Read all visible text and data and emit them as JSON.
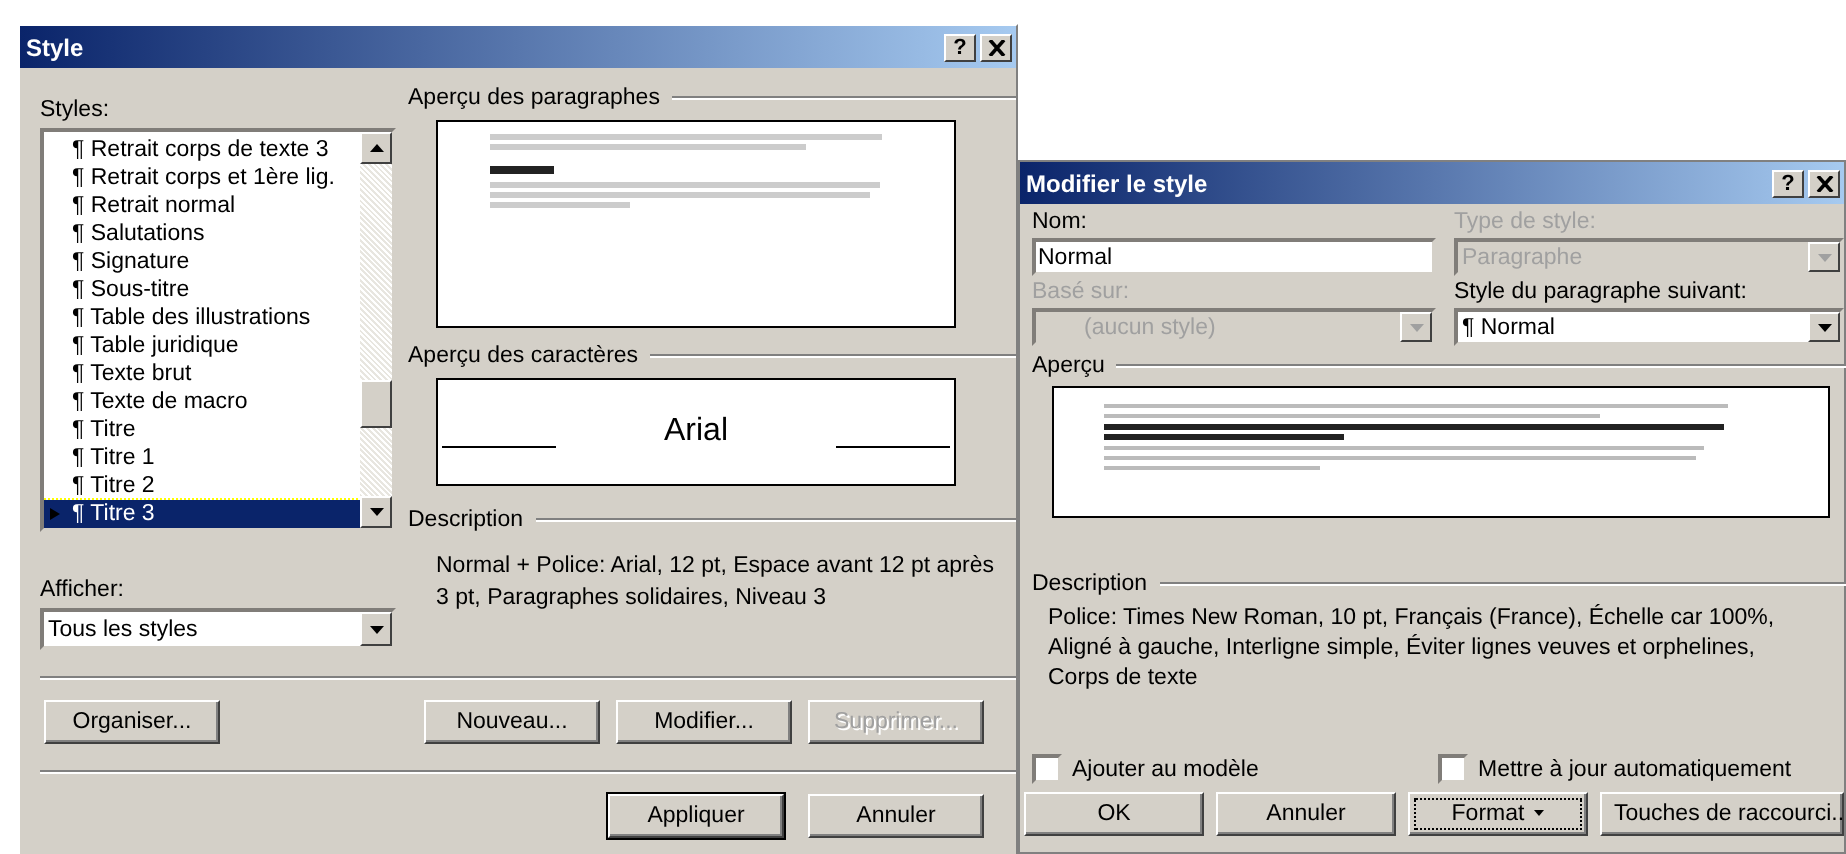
{
  "style_dialog": {
    "title": "Style",
    "help": "?",
    "styles_label": "Styles:",
    "styles": [
      {
        "label": "¶ Retrait corps de texte 3",
        "selected": false
      },
      {
        "label": "¶ Retrait corps et 1ère lig.",
        "selected": false
      },
      {
        "label": "¶ Retrait normal",
        "selected": false
      },
      {
        "label": "¶ Salutations",
        "selected": false
      },
      {
        "label": "¶ Signature",
        "selected": false
      },
      {
        "label": "¶ Sous-titre",
        "selected": false
      },
      {
        "label": "¶ Table des illustrations",
        "selected": false
      },
      {
        "label": "¶ Table juridique",
        "selected": false
      },
      {
        "label": "¶ Texte brut",
        "selected": false
      },
      {
        "label": "¶ Texte de macro",
        "selected": false
      },
      {
        "label": "¶ Titre",
        "selected": false
      },
      {
        "label": "¶ Titre 1",
        "selected": false
      },
      {
        "label": "¶ Titre 2",
        "selected": false
      },
      {
        "label": "¶ Titre 3",
        "selected": true
      }
    ],
    "show_label": "Afficher:",
    "show_value": "Tous les styles",
    "paragraph_preview_label": "Aperçu des paragraphes",
    "character_preview_label": "Aperçu des caractères",
    "character_preview_font": "Arial",
    "description_label": "Description",
    "description": "Normal + Police: Arial, 12 pt, Espace avant 12 pt après 3 pt, Paragraphes solidaires, Niveau 3",
    "action_buttons": [
      {
        "label": "Organiser...",
        "disabled": false
      },
      {
        "label": "Nouveau...",
        "disabled": false
      },
      {
        "label": "Modifier...",
        "disabled": false
      },
      {
        "label": "Supprimer...",
        "disabled": true
      }
    ],
    "bottom_buttons": [
      {
        "label": "Appliquer",
        "default": true
      },
      {
        "label": "Annuler",
        "default": false
      }
    ]
  },
  "modify_dialog": {
    "title": "Modifier le style",
    "help": "?",
    "fields": [
      {
        "label": "Nom:",
        "value": "Normal",
        "kind": "text",
        "disabled": false
      },
      {
        "label": "Type de style:",
        "value": "Paragraphe",
        "kind": "dropdown",
        "disabled": true
      },
      {
        "label": "Basé sur:",
        "value": "(aucun style)",
        "kind": "dropdown",
        "disabled": true
      },
      {
        "label": "Style du paragraphe suivant:",
        "value": "¶ Normal",
        "kind": "dropdown",
        "disabled": false
      }
    ],
    "preview_label": "Aperçu",
    "description_label": "Description",
    "description": "Police: Times New Roman, 10 pt, Français (France), Échelle car 100%, Aligné à gauche, Interligne simple, Éviter lignes veuves et orphelines, Corps de texte",
    "checkboxes": [
      {
        "label": "Ajouter au modèle",
        "checked": false
      },
      {
        "label": "Mettre à jour automatiquement",
        "checked": false
      }
    ],
    "buttons": [
      {
        "label": "OK",
        "kind": "plain",
        "focused": false
      },
      {
        "label": "Annuler",
        "kind": "plain",
        "focused": false
      },
      {
        "label": "Format",
        "kind": "menu",
        "focused": true
      },
      {
        "label": "Touches de raccourci...",
        "kind": "plain",
        "focused": false
      }
    ]
  }
}
